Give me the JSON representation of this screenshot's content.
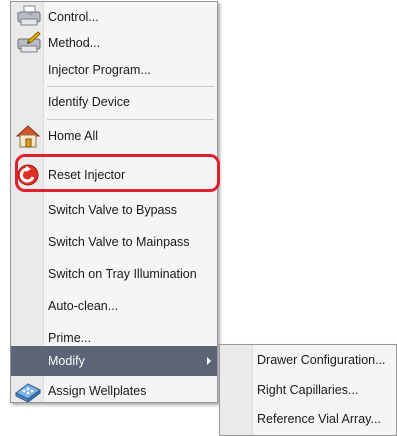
{
  "menu": {
    "items": [
      {
        "label": "Control...",
        "icon": "control-printer-icon"
      },
      {
        "label": "Method...",
        "icon": "method-printer-icon"
      },
      {
        "label": "Injector Program..."
      },
      {
        "label": "Identify Device"
      },
      {
        "label": "Home All",
        "icon": "home-icon"
      },
      {
        "label": "Reset Injector",
        "icon": "reset-injector-icon"
      },
      {
        "label": "Switch Valve to Bypass"
      },
      {
        "label": "Switch Valve to Mainpass"
      },
      {
        "label": "Switch on Tray Illumination"
      },
      {
        "label": "Auto-clean..."
      },
      {
        "label": "Prime..."
      },
      {
        "label": "Modify",
        "has_submenu": true,
        "selected": true
      },
      {
        "label": "Assign Wellplates",
        "icon": "wellplate-icon"
      }
    ]
  },
  "submenu": {
    "items": [
      {
        "label": "Drawer Configuration..."
      },
      {
        "label": "Right Capillaries..."
      },
      {
        "label": "Reference Vial Array..."
      }
    ]
  },
  "colors": {
    "selected_background": "#5c6478",
    "highlight_ring": "#e0202e"
  }
}
